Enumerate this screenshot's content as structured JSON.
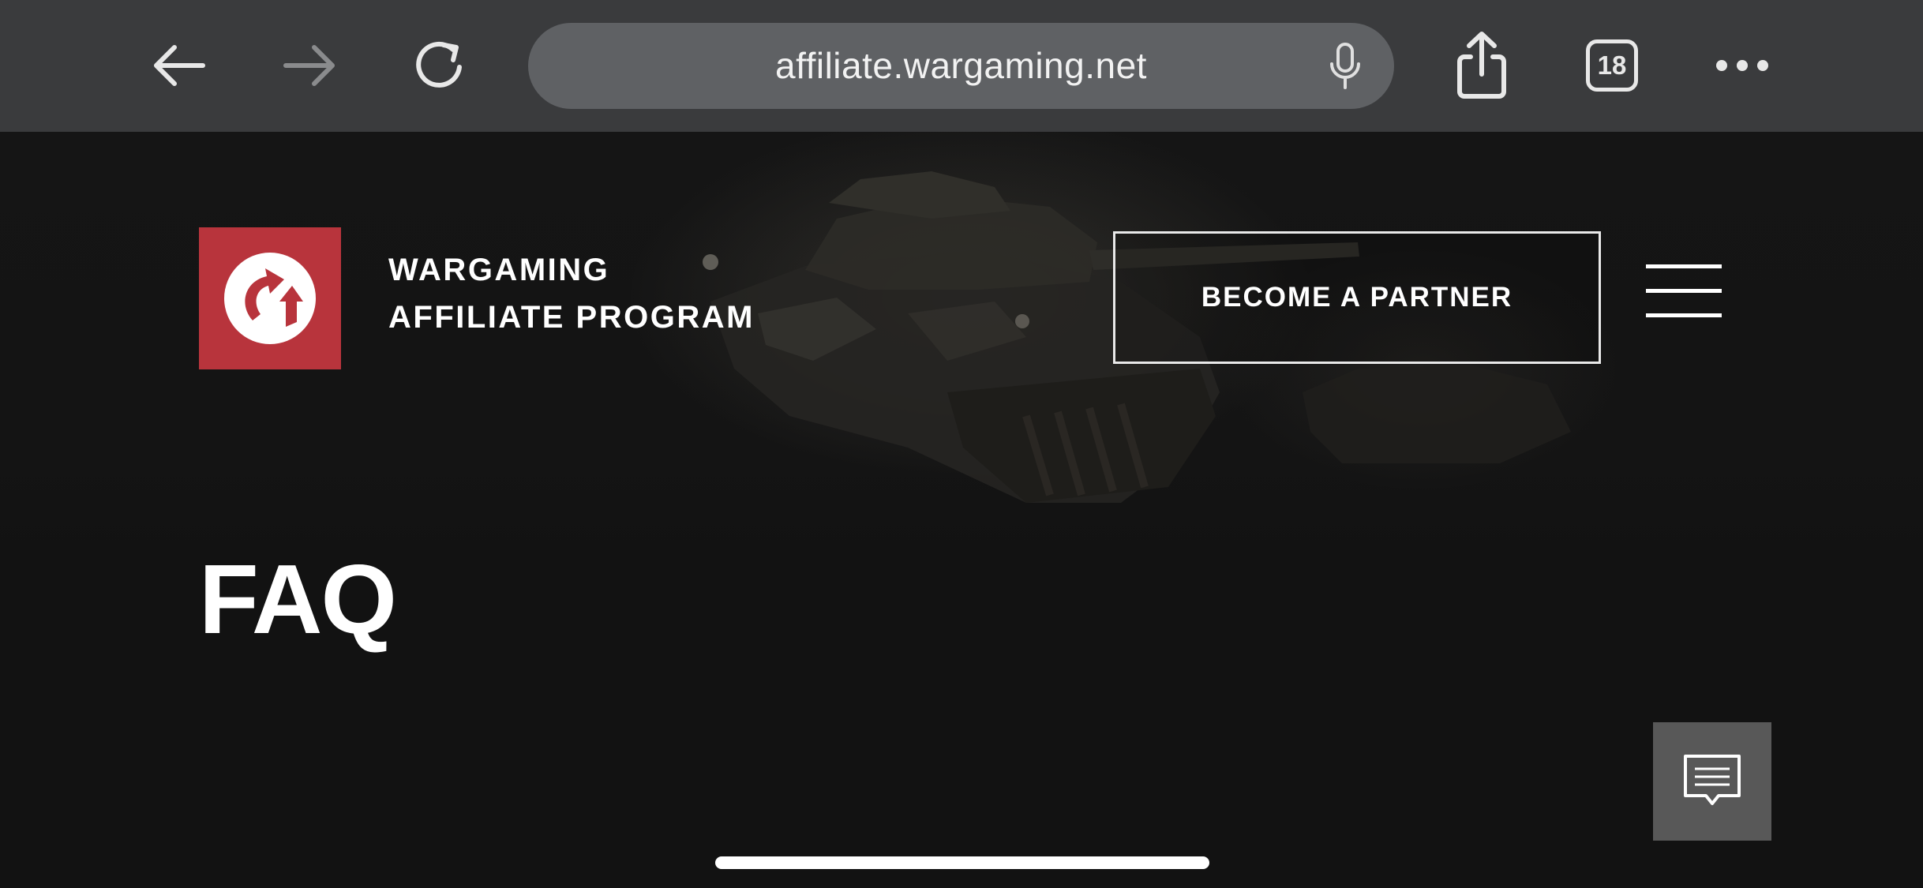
{
  "browser": {
    "url": "affiliate.wargaming.net",
    "tab_count": "18",
    "icons": {
      "back": "arrow-left-icon",
      "forward": "arrow-right-icon",
      "reload": "reload-icon",
      "mic": "microphone-icon",
      "share": "share-icon",
      "tabs": "tabs-icon",
      "more": "more-icon"
    }
  },
  "header": {
    "brand_line_1": "WARGAMING",
    "brand_line_2": "AFFILIATE PROGRAM",
    "partner_button": "BECOME A PARTNER",
    "logo_color": "#b8343c"
  },
  "main": {
    "title": "FAQ"
  },
  "colors": {
    "toolbar": "#3a3b3d",
    "urlbar": "#5f6164",
    "page_bg": "#121212",
    "chat_button": "#585858"
  }
}
